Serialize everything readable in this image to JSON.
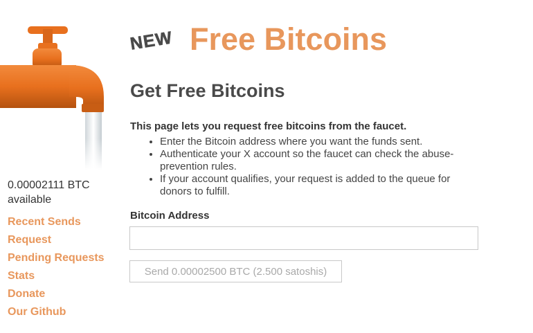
{
  "header": {
    "new_badge": "NEW",
    "site_title": "Free Bitcoins"
  },
  "sidebar": {
    "balance": "0.00002111 BTC available",
    "nav": [
      {
        "label": "Recent Sends"
      },
      {
        "label": "Request"
      },
      {
        "label": "Pending Requests"
      },
      {
        "label": "Stats"
      },
      {
        "label": "Donate"
      },
      {
        "label": "Our Github"
      }
    ]
  },
  "main": {
    "heading": "Get Free Bitcoins",
    "intro": "This page lets you request free bitcoins from the faucet.",
    "steps": [
      "Enter the Bitcoin address where you want the funds sent.",
      "Authenticate your X account so the faucet can check the abuse-prevention rules.",
      "If your account qualifies, your request is added to the queue for donors to fulfill."
    ],
    "address_label": "Bitcoin Address",
    "address_value": "",
    "send_button": "Send 0.00002500 BTC (2.500 satoshis)"
  },
  "colors": {
    "accent": "#e8975c",
    "faucet_orange": "#e8701e",
    "heading": "#4a4a4a"
  }
}
